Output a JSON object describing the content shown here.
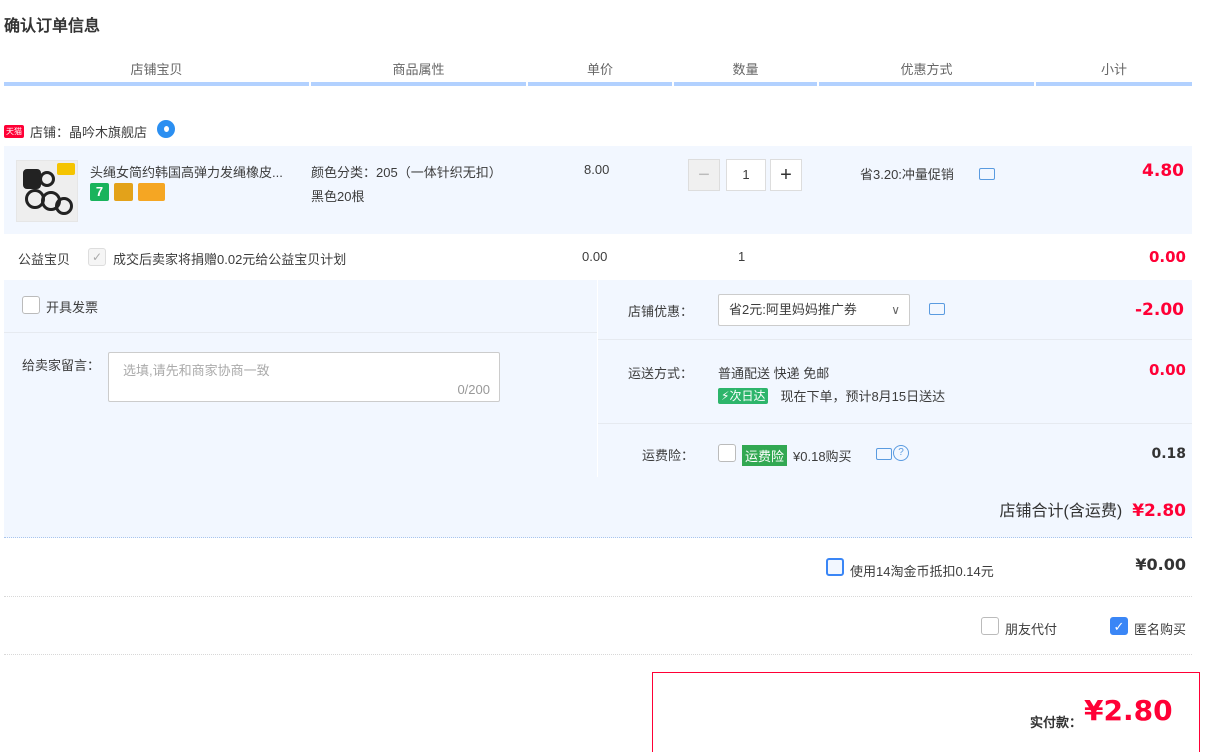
{
  "page_title": "确认订单信息",
  "columns": [
    "店铺宝贝",
    "商品属性",
    "单价",
    "数量",
    "优惠方式",
    "小计"
  ],
  "shop": {
    "tmall_logo": "天猫",
    "label": "店铺：",
    "name": "晶吟木旗舰店"
  },
  "item": {
    "title": "头绳女简约韩国高弹力发绳橡皮...",
    "attribute_line1": "颜色分类：205（一体针织无扣）",
    "attribute_line2": "黑色20根",
    "unit_price": "8.00",
    "quantity": "1",
    "discount": "省3.20:冲量促销",
    "subtotal": "4.80",
    "badge_colors": [
      "#19b35c",
      "#e3a21a",
      "#f5a623"
    ]
  },
  "charity": {
    "label": "公益宝贝",
    "text": "成交后卖家将捐赠0.02元给公益宝贝计划",
    "price": "0.00",
    "qty": "1",
    "subtotal": "0.00"
  },
  "invoice_label": "开具发票",
  "message": {
    "label": "给卖家留言：",
    "placeholder": "选填,请先和商家协商一致",
    "counter": "0/200"
  },
  "shop_discount": {
    "label": "店铺优惠：",
    "selected": "省2元:阿里妈妈推广券",
    "amount": "-2.00"
  },
  "shipping": {
    "label": "运送方式：",
    "method": "普通配送 快递 免邮",
    "tag": "次日达",
    "eta": "现在下单，预计8月15日送达",
    "amount": "0.00"
  },
  "insurance": {
    "label": "运费险：",
    "tag": "运费险",
    "price_text": "¥0.18购买",
    "amount": "0.18"
  },
  "shop_total": {
    "label": "店铺合计(含运费)",
    "amount": "¥2.80"
  },
  "coins": {
    "text": "使用14淘金币抵扣0.14元",
    "amount": "¥0.00"
  },
  "options": {
    "friend_pay": "朋友代付",
    "anonymous": "匿名购买"
  },
  "final": {
    "label": "实付款：",
    "amount": "¥2.80"
  },
  "colors": {
    "accent_red": "#ff0036",
    "header_blue": "#b2d1ff",
    "panel_bg": "#f2f7ff",
    "checkbox_blue": "#3a86f6"
  }
}
